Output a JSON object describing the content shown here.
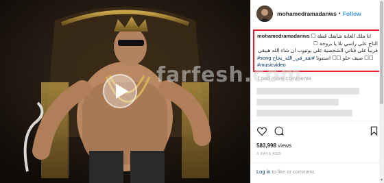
{
  "post": {
    "username": "mohamedramadanws",
    "follow_separator": "•",
    "follow_label": "Follow",
    "caption": {
      "username": "mohamedramadanws",
      "line1": "انا ملك الغابة شايفك قطة ☐",
      "line2": "التاج على راسي بلا يا بروجة ☐",
      "line3": "قريباً على قناتي الشخصية على يوتيوب ان شاء الله هيبقى",
      "line4_hashtag_song": "#song",
      "line4_text": "☐☐ صيف حلو ☐☐ استنونا",
      "line4_hashtag_arabic": "#ثقة_في_الله_نجاح",
      "line5_hashtag": "#musicvideo"
    },
    "load_more_label": "Load more comments",
    "views_count": "583,998",
    "views_label": "views",
    "timestamp": "3 DAYS AGO",
    "login_link": "Log in",
    "login_text": "to like or comment."
  },
  "watermark": "farfesh.com",
  "icons": {
    "like": "heart-icon",
    "comment": "comment-icon",
    "save": "bookmark-icon",
    "play": "play-icon"
  },
  "colors": {
    "accent": "#3897f0",
    "highlight_box": "#e0202a",
    "hashtag": "#003569",
    "muted": "#999999"
  }
}
